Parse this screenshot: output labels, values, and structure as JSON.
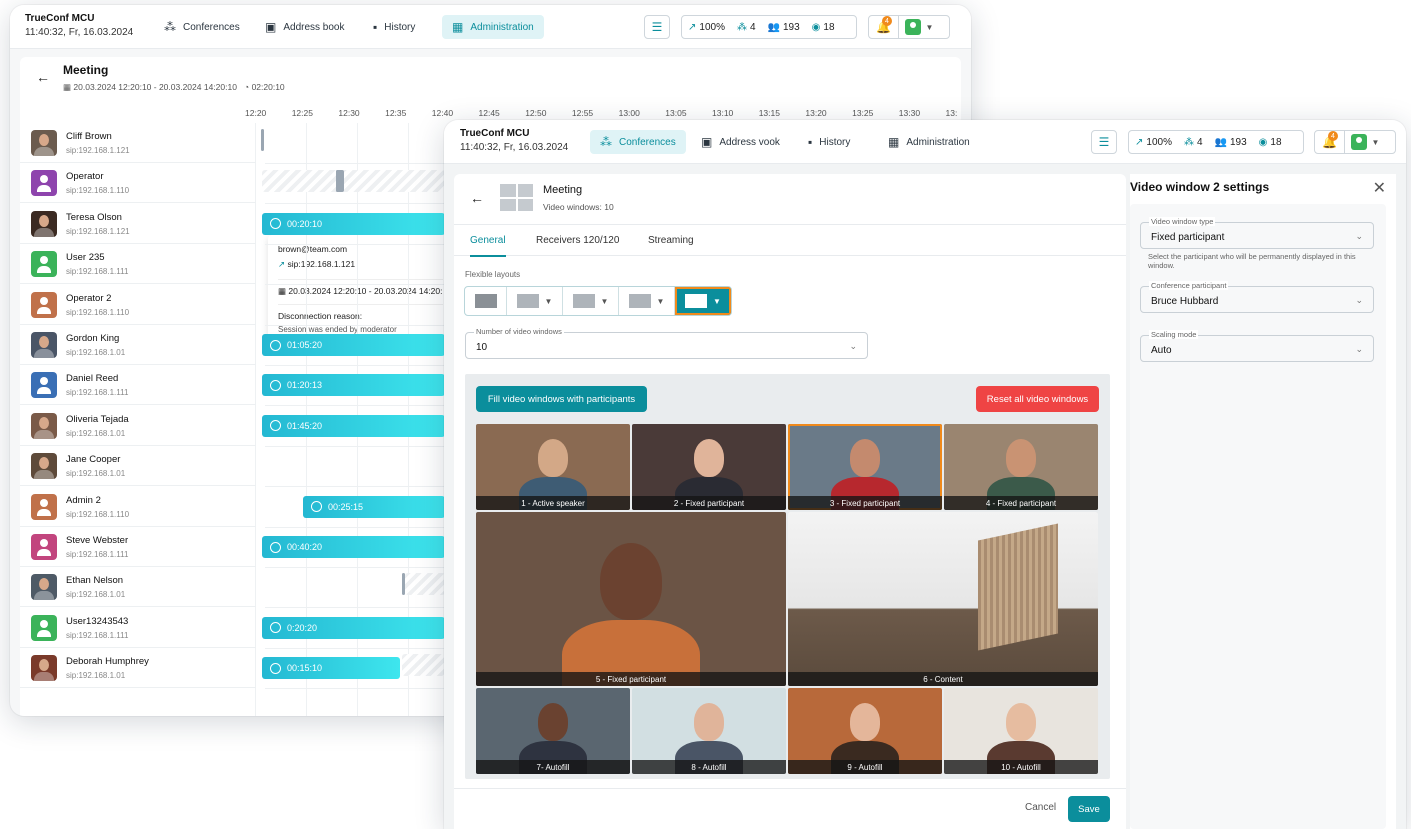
{
  "back_window": {
    "brand": {
      "name": "TrueConf MCU",
      "time": "11:40:32, Fr, 16.03.2024"
    },
    "nav": [
      {
        "label": "Conferences",
        "icon": "conference-icon"
      },
      {
        "label": "Address book",
        "icon": "address-book-icon"
      },
      {
        "label": "History",
        "icon": "history-icon"
      },
      {
        "label": "Administration",
        "icon": "administration-icon",
        "active": true
      }
    ],
    "stats": {
      "cpu": "100%",
      "conf": "4",
      "users": "193",
      "streams": "18"
    },
    "notifications": "4",
    "meeting": {
      "title": "Meeting",
      "range": "20.03.2024 12:20:10 - 20.03.2024 14:20:10",
      "duration": "02:20:10"
    },
    "ticks": [
      "12:20",
      "12:25",
      "12:30",
      "12:35",
      "12:40",
      "12:45",
      "12:50",
      "12:55",
      "13:00",
      "13:05",
      "13:10",
      "13:15",
      "13:20",
      "13:25",
      "13:30",
      "13:"
    ],
    "participants": [
      {
        "name": "Cliff Brown",
        "sip": "sip:192.168.1.121"
      },
      {
        "name": "Operator",
        "sip": "sip:192.168.1.110"
      },
      {
        "name": "Teresa Olson",
        "sip": "sip:192.168.1.121",
        "bar": "00:20:10"
      },
      {
        "name": "User 235",
        "sip": "sip:192.168.1.111"
      },
      {
        "name": "Operator 2",
        "sip": "sip:192.168.1.110"
      },
      {
        "name": "Gordon King",
        "sip": "sip:192.168.1.01",
        "bar": "01:05:20"
      },
      {
        "name": "Daniel Reed",
        "sip": "sip:192.168.1.111",
        "bar": "01:20:13"
      },
      {
        "name": "Oliveria Tejada",
        "sip": "sip:192.168.1.01",
        "bar": "01:45:20"
      },
      {
        "name": "Jane Cooper",
        "sip": "sip:192.168.1.01"
      },
      {
        "name": "Admin 2",
        "sip": "sip:192.168.1.110",
        "bar": "00:25:15"
      },
      {
        "name": "Steve Webster",
        "sip": "sip:192.168.1.111",
        "bar": "00:40:20"
      },
      {
        "name": "Ethan Nelson",
        "sip": "sip:192.168.1.01"
      },
      {
        "name": "User13243543",
        "sip": "sip:192.168.1.111",
        "bar": "0:20:20"
      },
      {
        "name": "Deborah Humphrey",
        "sip": "sip:192.168.1.01",
        "bar": "00:15:10"
      }
    ],
    "tooltip": {
      "email": "brown@team.com",
      "sip": "sip:192.168.1.121",
      "range": "20.03.2024 12:20:10 - 20.03.2024 14:20:1",
      "reason_label": "Disconnection reason:",
      "reason": "Session was ended by moderator"
    }
  },
  "front_window": {
    "brand": {
      "name": "TrueConf MCU",
      "time": "11:40:32, Fr, 16.03.2024"
    },
    "nav": [
      {
        "label": "Conferences",
        "icon": "conference-icon",
        "active": true
      },
      {
        "label": "Address vook",
        "icon": "address-book-icon"
      },
      {
        "label": "History",
        "icon": "history-icon"
      },
      {
        "label": "Administration",
        "icon": "administration-icon"
      }
    ],
    "stats": {
      "cpu": "100%",
      "conf": "4",
      "users": "193",
      "streams": "18"
    },
    "notifications": "4",
    "meeting": {
      "title": "Meeting",
      "subtitle": "Video windows: 10"
    },
    "tabs": [
      "General",
      "Receivers 120/120",
      "Streaming"
    ],
    "flexible_layouts_label": "Flexible layouts",
    "num_windows": {
      "label": "Number of video windows",
      "value": "10"
    },
    "fill_button": "Fill video windows with participants",
    "reset_button": "Reset all video windows",
    "tiles": [
      "1 - Active speaker",
      "2 - Fixed participant",
      "3 - Fixed participant",
      "4 - Fixed participant",
      "5 - Fixed participant",
      "6 - Content",
      "7- Autofill",
      "8 - Autofill",
      "9 - Autofill",
      "10 - Autofill"
    ],
    "cancel": "Cancel",
    "save": "Save",
    "settings": {
      "title": "Video window 2 settings",
      "type_label": "Video window type",
      "type_value": "Fixed participant",
      "type_hint": "Select the participant who will be permanently displayed in this window.",
      "participant_label": "Conference participant",
      "participant_value": "Bruce Hubbard",
      "scaling_label": "Scaling mode",
      "scaling_value": "Auto"
    }
  },
  "colors": {
    "accent": "#0b8e9c",
    "danger": "#ef4444",
    "bar": "#2cc9de",
    "selected": "#f08a1c"
  }
}
